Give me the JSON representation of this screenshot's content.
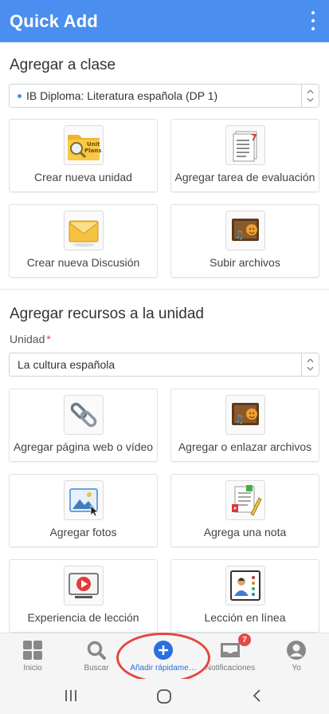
{
  "appbar": {
    "title": "Quick Add"
  },
  "section_class": {
    "title": "Agregar a clase",
    "selected_class": "IB Diploma: Literatura española (DP 1)",
    "cards": [
      {
        "label": "Crear nueva unidad",
        "icon": "unit-plans-icon"
      },
      {
        "label": "Agregar tarea de evaluación",
        "icon": "assessment-task-icon"
      },
      {
        "label": "Crear nueva Discusión",
        "icon": "envelope-icon"
      },
      {
        "label": "Subir archivos",
        "icon": "media-files-icon"
      }
    ]
  },
  "section_unit": {
    "title": "Agregar recursos a la unidad",
    "unit_label": "Unidad",
    "required_mark": "*",
    "selected_unit": "La cultura española",
    "cards": [
      {
        "label": "Agregar página web o vídeo",
        "icon": "link-chain-icon"
      },
      {
        "label": "Agregar o enlazar archivos",
        "icon": "media-files-icon"
      },
      {
        "label": "Agregar fotos",
        "icon": "photo-icon"
      },
      {
        "label": "Agrega una nota",
        "icon": "note-pencil-icon"
      },
      {
        "label": "Experiencia de lección",
        "icon": "video-player-icon"
      },
      {
        "label": "Lección en línea",
        "icon": "online-lesson-icon"
      }
    ]
  },
  "bottom_nav": {
    "items": [
      {
        "label": "Inicio",
        "icon": "grid-icon"
      },
      {
        "label": "Buscar",
        "icon": "search-icon"
      },
      {
        "label": "Añadir rápidame…",
        "icon": "add-circle-icon",
        "active": true
      },
      {
        "label": "Notificaciones",
        "icon": "inbox-icon",
        "badge": "7"
      },
      {
        "label": "Yo",
        "icon": "user-avatar-icon"
      }
    ]
  },
  "colors": {
    "brand": "#4a8ff0",
    "highlight": "#e2473f",
    "badge": "#e24a4a"
  }
}
